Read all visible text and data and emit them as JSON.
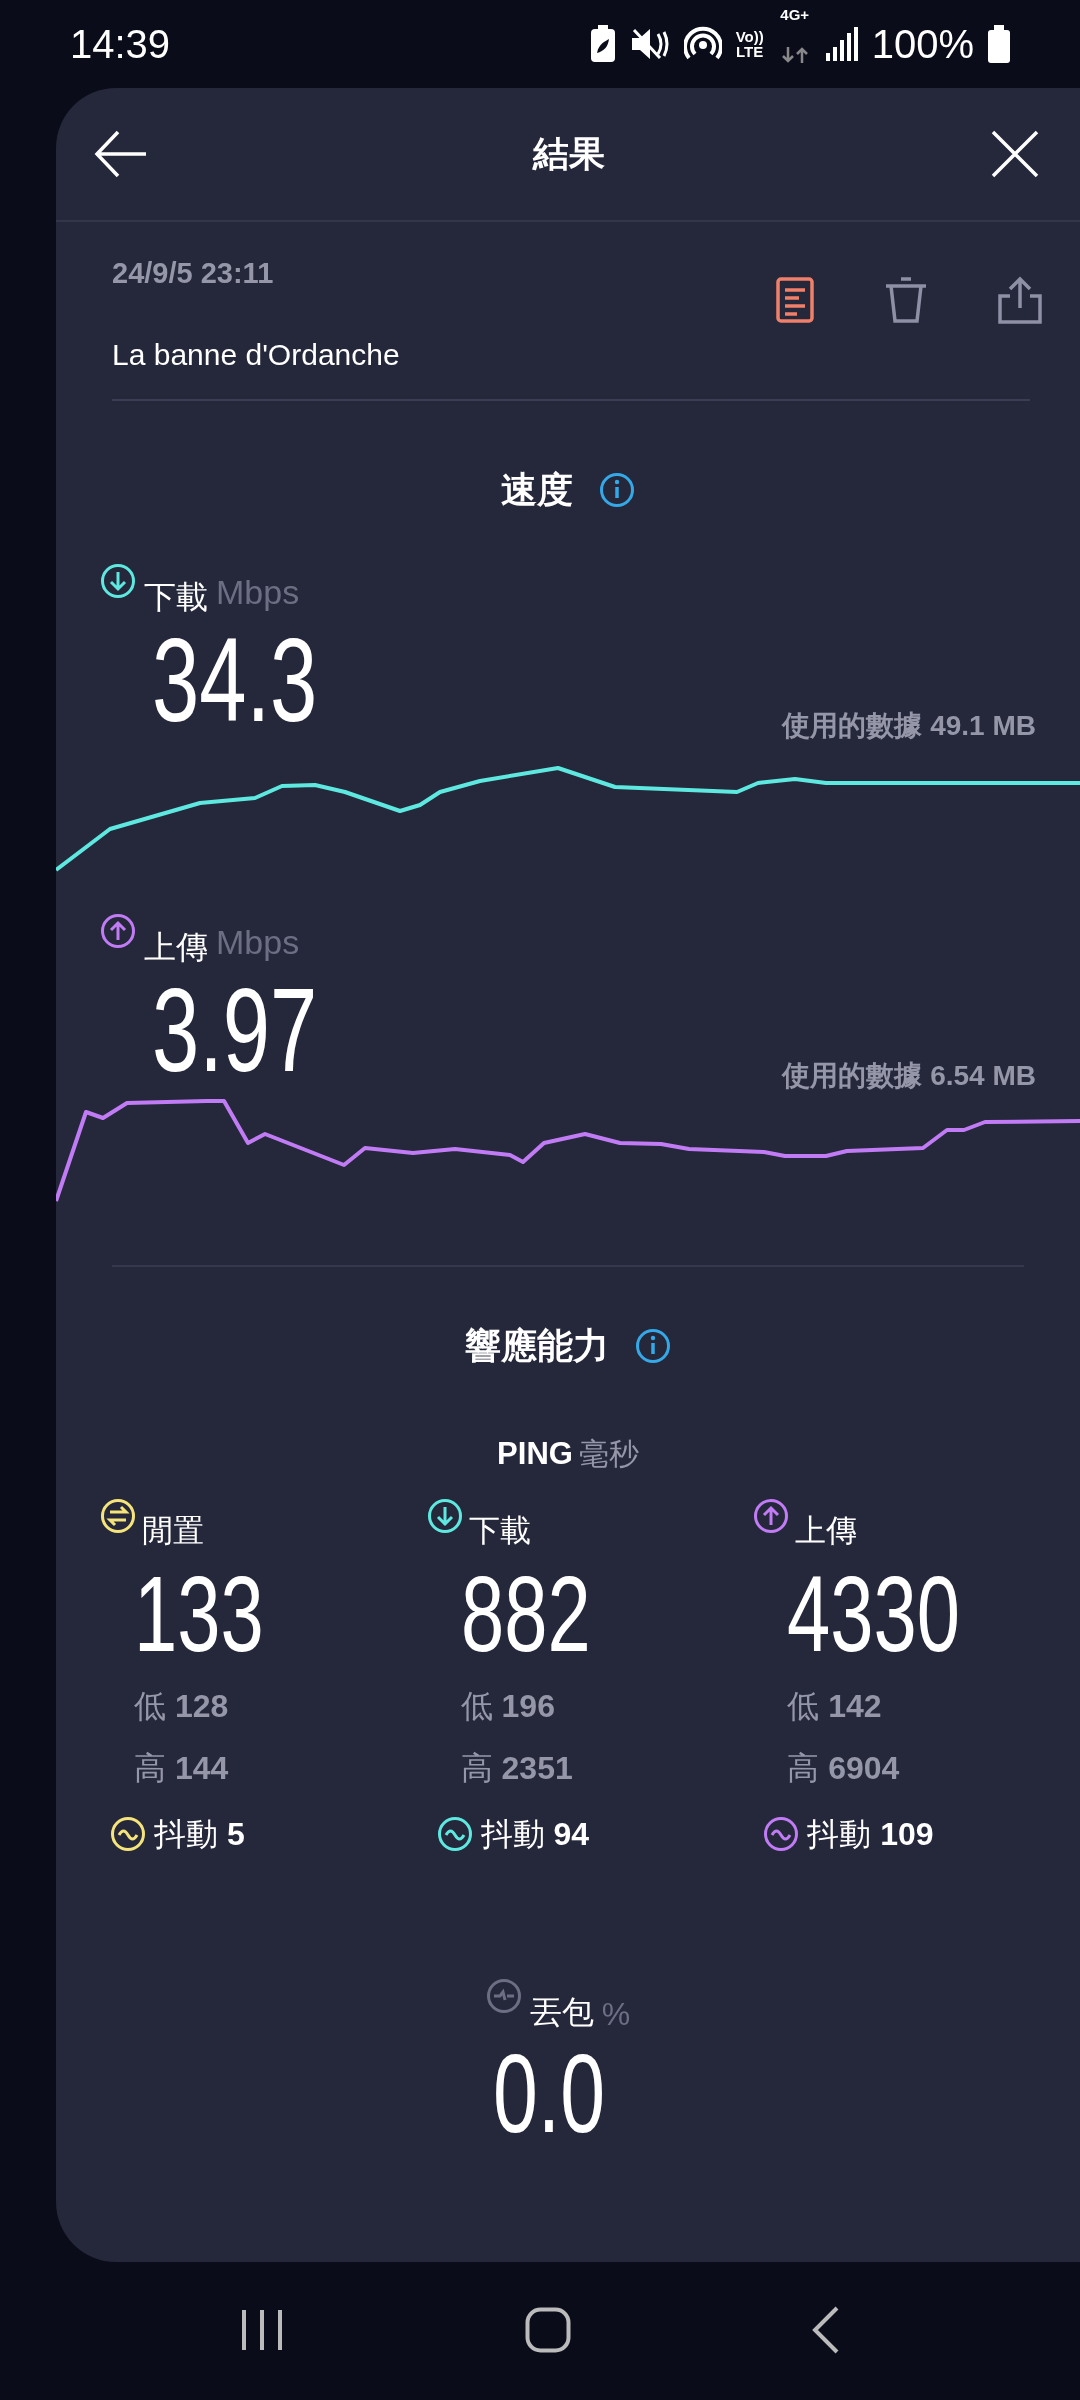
{
  "status_bar": {
    "time": "14:39",
    "volte_top": "Vo))",
    "volte_bottom": "LTE",
    "network": "4G+",
    "battery": "100%"
  },
  "header": {
    "title": "結果"
  },
  "result": {
    "date": "24/9/5 23:11",
    "location": "La banne d'Ordanche"
  },
  "speed": {
    "title": "速度",
    "metrics": [
      {
        "kind": "download",
        "label": "下載",
        "unit": "Mbps",
        "value": "34.3",
        "data_used": "使用的數據 49.1 MB",
        "color": "#5ee9e0"
      },
      {
        "kind": "upload",
        "label": "上傳",
        "unit": "Mbps",
        "value": "3.97",
        "data_used": "使用的數據 6.54 MB",
        "color": "#c17cf5"
      }
    ]
  },
  "responsiveness": {
    "title": "響應能力",
    "ping_label": "PING",
    "ping_unit": "毫秒",
    "columns": [
      {
        "kind": "idle",
        "label": "閒置",
        "value": "133",
        "low_label": "低",
        "low": "128",
        "high_label": "高",
        "high": "144",
        "jitter_label": "抖動",
        "jitter": "5",
        "color": "#f5e47a"
      },
      {
        "kind": "download",
        "label": "下載",
        "value": "882",
        "low_label": "低",
        "low": "196",
        "high_label": "高",
        "high": "2351",
        "jitter_label": "抖動",
        "jitter": "94",
        "color": "#5ee9e0"
      },
      {
        "kind": "upload",
        "label": "上傳",
        "value": "4330",
        "low_label": "低",
        "low": "142",
        "high_label": "高",
        "high": "6904",
        "jitter_label": "抖動",
        "jitter": "109",
        "color": "#c17cf5"
      }
    ]
  },
  "packet_loss": {
    "label": "丟包",
    "unit": "%",
    "value": "0.0"
  }
}
